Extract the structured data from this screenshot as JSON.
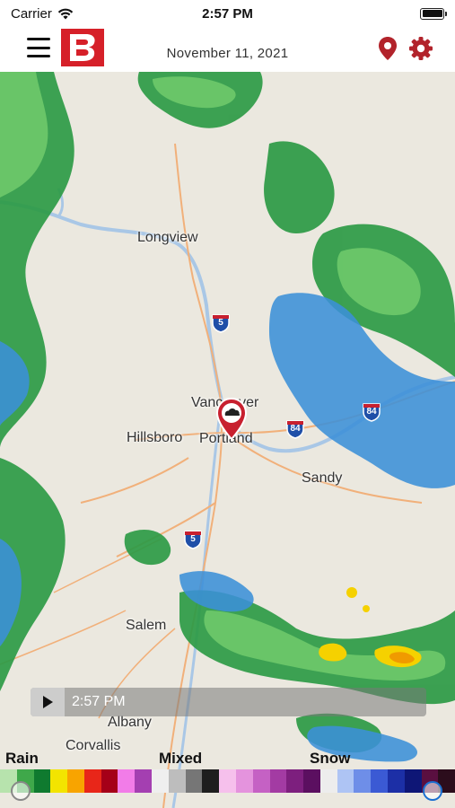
{
  "status_bar": {
    "carrier": "Carrier",
    "time": "2:57 PM"
  },
  "header": {
    "date": "November 11, 2021",
    "brand_color": "#d62029"
  },
  "map": {
    "cities": [
      "Longview",
      "Vancouver",
      "Hillsboro",
      "Portland",
      "Sandy",
      "Salem",
      "Albany",
      "Corvallis"
    ],
    "highway_shields": [
      "5",
      "84",
      "84",
      "5"
    ],
    "radar_colors": {
      "rain_light": "#6ec96a",
      "rain_heavy": "#1a8c3a",
      "drizzle": "#3b8fd8",
      "moderate": "#f5d100",
      "heavy": "#f09a00"
    }
  },
  "playback": {
    "time": "2:57 PM"
  },
  "legend": {
    "rain": "Rain",
    "mixed": "Mixed",
    "snow": "Snow",
    "colors": [
      "#b7e3ad",
      "#3fa84a",
      "#0f7a2f",
      "#f3e400",
      "#f8a400",
      "#e82619",
      "#a50018",
      "#f27ce8",
      "#a43fb1",
      "#efefef",
      "#bdbdbd",
      "#767676",
      "#1e1e1e",
      "#f6c0ec",
      "#e493dd",
      "#c561c4",
      "#a33ba3",
      "#7d1f7e",
      "#5b0f60",
      "#ededed",
      "#aec4f4",
      "#6e8ee8",
      "#3b5ad4",
      "#1c2fa6",
      "#0e1676",
      "#5a0f40",
      "#2c0d1c"
    ]
  }
}
